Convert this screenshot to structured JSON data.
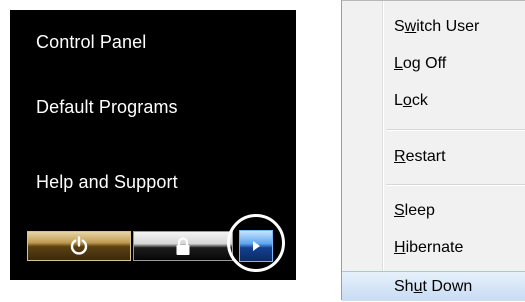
{
  "start_menu": {
    "links": {
      "control_panel": "Control Panel",
      "default_programs": "Default Programs",
      "help_and_support": "Help and Support"
    },
    "buttons": {
      "shutdown_icon": "power-icon",
      "lock_icon": "padlock-icon",
      "options_icon": "right-arrow-icon"
    }
  },
  "options_menu": {
    "items": [
      {
        "pre": "S",
        "key": "w",
        "post": "itch User"
      },
      {
        "pre": "",
        "key": "L",
        "post": "og Off"
      },
      {
        "pre": "L",
        "key": "o",
        "post": "ck"
      },
      {
        "pre": "",
        "key": "R",
        "post": "estart"
      },
      {
        "pre": "",
        "key": "S",
        "post": "leep"
      },
      {
        "pre": "",
        "key": "H",
        "post": "ibernate"
      },
      {
        "pre": "Sh",
        "key": "u",
        "post": "t Down"
      }
    ],
    "highlighted_item": "Shut Down"
  },
  "colors": {
    "start_menu_bg": "#000000",
    "shutdown_button_gold": "#c09b52",
    "options_button_blue": "#5ea7ef",
    "menu_bg": "#f1f1f1",
    "highlight": "#c9dcf3"
  }
}
